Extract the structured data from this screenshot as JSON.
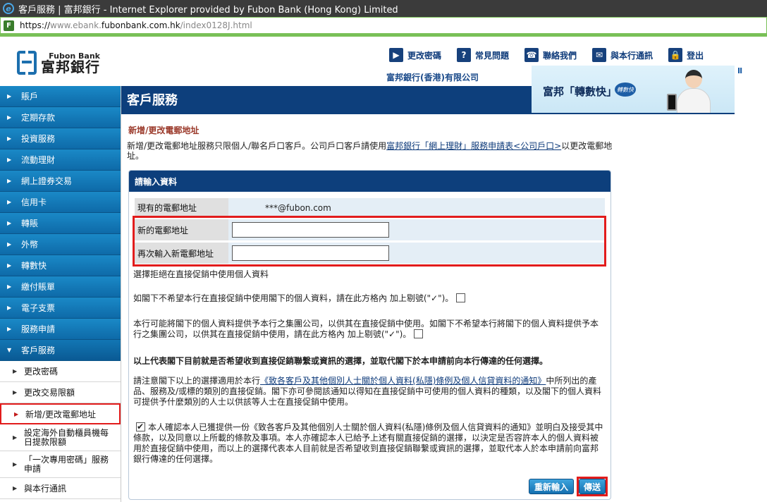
{
  "window": {
    "title": "客戶服務 | 富邦銀行 - Internet Explorer provided by Fubon Bank (Hong Kong) Limited",
    "url_scheme": "https://",
    "url_pre": "www.ebank.",
    "url_host": "fubonbank.com.hk",
    "url_path": "/index0128J.html"
  },
  "header": {
    "logo_en": "Fubon Bank",
    "logo_zh": "富邦銀行",
    "nav": [
      {
        "label": "更改密碼",
        "icon": "▶"
      },
      {
        "label": "常見問題",
        "icon": "?"
      },
      {
        "label": "聯絡我們",
        "icon": "☎"
      },
      {
        "label": "與本行通訊",
        "icon": "✉"
      },
      {
        "label": "登出",
        "icon": "🔒"
      }
    ],
    "bank_name": "富邦銀行(香港)有限公司",
    "banner_text": "富邦「轉數快」",
    "banner_badge": "轉數快",
    "pause": "II"
  },
  "sidebar": {
    "items": [
      "賬戶",
      "定期存款",
      "投資服務",
      "流動理財",
      "網上證券交易",
      "信用卡",
      "轉賬",
      "外幣",
      "轉數快",
      "繳付賬單",
      "電子支票",
      "服務申請"
    ],
    "open_item": "客戶服務",
    "sub_items": [
      "更改密碼",
      "更改交易限額",
      "新增/更改電郵地址",
      "設定海外自動櫃員機每日提款限額",
      "「一次專用密碼」服務申請",
      "與本行通訊"
    ]
  },
  "main": {
    "page_title": "客戶服務",
    "section_title": "新增/更改電郵地址",
    "intro_text": "新增/更改電郵地址服務只限個人/聯名戶口客戶。公司戶口客戶請使用",
    "intro_link": "富邦銀行「網上理財」服務申請表<公司戶口>",
    "intro_tail": "以更改電郵地址。",
    "panel_title": "請輸入資料",
    "current_email_label": "現有的電郵地址",
    "current_email_value": "***@fubon.com",
    "new_email_label": "新的電郵地址",
    "new_email_value": "",
    "confirm_email_label": "再次輸入新電郵地址",
    "confirm_email_value": "",
    "dm_title": "選擇拒絕在直接促銷中使用個人資料",
    "dm_opt1": "如閣下不希望本行在直接促銷中使用閣下的個人資料，請在此方格內 加上剔號(\"✓\")。",
    "dm_opt2": "本行可能將閣下的個人資料提供予本行之集團公司，以供其在直接促銷中使用。如閣下不希望本行將閣下的個人資料提供予本行之集團公司，以供其在直接促銷中使用，請在此方格內 加上剔號(\"✓\")。",
    "dm_statement": "以上代表閣下目前就是否希望收到直接促銷聯繫或資訊的選擇，並取代閣下於本申請前向本行傳達的任何選擇。",
    "notice_pre": "請注意閣下以上的選擇適用於本行",
    "notice_link": "《致各客戶及其他個別人士關於個人資料(私隱)條例及個人信貸資料的通知》",
    "notice_post": "中所列出的產品、服務及/或標的類別的直接促銷。閣下亦可參閱該通知以得知在直接促銷中可使用的個人資料的種類，以及閣下的個人資料可提供予什麼類別的人士以供該等人士在直接促銷中使用。",
    "confirm_text": "本人確認本人已獲提供一份《致各客戶及其他個別人士關於個人資料(私隱)條例及個人信貸資料的通知》並明白及接受其中條款，以及同意以上所載的條款及事項。本人亦確認本人已給予上述有關直接促銷的選擇，以決定是否容許本人的個人資料被用於直接促銷中使用，而以上的選擇代表本人目前就是否希望收到直接促銷聯繫或資訊的選擇，並取代本人於本申請前向富邦銀行傳達的任何選擇。",
    "reset_label": "重新輸入",
    "submit_label": "傳送"
  },
  "colors": {
    "brand_navy": "#0d3f7c",
    "nav_blue": "#1a89c7",
    "highlight_red": "#e21c1c",
    "section_title": "#9b3a2b"
  }
}
